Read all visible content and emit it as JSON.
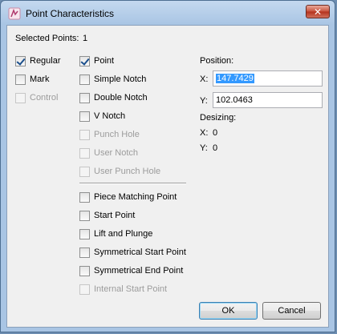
{
  "window": {
    "title": "Point Characteristics",
    "close_glyph": "✕",
    "icon": "app-icon"
  },
  "selected_points": {
    "label": "Selected Points:",
    "value": "1"
  },
  "type_options": [
    {
      "label": "Regular",
      "checked": true,
      "enabled": true
    },
    {
      "label": "Mark",
      "checked": false,
      "enabled": true
    },
    {
      "label": "Control",
      "checked": false,
      "enabled": false
    }
  ],
  "point_options": [
    {
      "label": "Point",
      "checked": true,
      "enabled": true
    },
    {
      "label": "Simple Notch",
      "checked": false,
      "enabled": true
    },
    {
      "label": "Double Notch",
      "checked": false,
      "enabled": true
    },
    {
      "label": "V Notch",
      "checked": false,
      "enabled": true
    },
    {
      "label": "Punch Hole",
      "checked": false,
      "enabled": false
    },
    {
      "label": "User Notch",
      "checked": false,
      "enabled": false
    },
    {
      "label": "User Punch Hole",
      "checked": false,
      "enabled": false
    }
  ],
  "extra_options": [
    {
      "label": "Piece Matching Point",
      "checked": false,
      "enabled": true
    },
    {
      "label": "Start Point",
      "checked": false,
      "enabled": true
    },
    {
      "label": "Lift and Plunge",
      "checked": false,
      "enabled": true
    },
    {
      "label": "Symmetrical Start Point",
      "checked": false,
      "enabled": true
    },
    {
      "label": "Symmetrical End Point",
      "checked": false,
      "enabled": true
    },
    {
      "label": "Internal Start Point",
      "checked": false,
      "enabled": false
    }
  ],
  "position": {
    "heading": "Position:",
    "x_label": "X:",
    "x_value": "147.7429",
    "y_label": "Y:",
    "y_value": "102.0463"
  },
  "desizing": {
    "heading": "Desizing:",
    "x_label": "X:",
    "x_value": "0",
    "y_label": "Y:",
    "y_value": "0"
  },
  "buttons": {
    "ok": "OK",
    "cancel": "Cancel"
  }
}
